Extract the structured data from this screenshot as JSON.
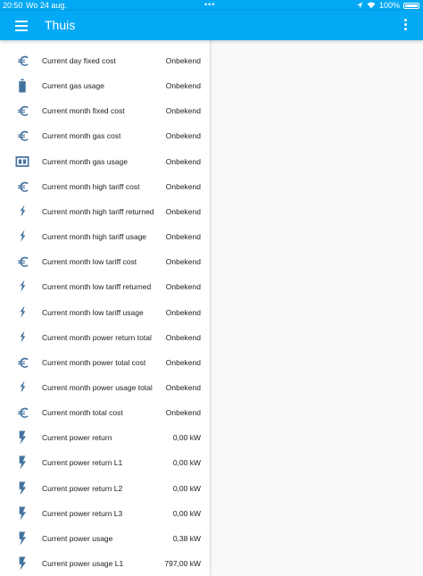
{
  "status_bar": {
    "time": "20:50",
    "date": "Wo 24 aug.",
    "battery": "100%"
  },
  "header": {
    "title": "Thuis"
  },
  "colors": {
    "primary": "#03a9f4",
    "icon": "#44739e",
    "text": "#212121"
  },
  "entities": [
    {
      "icon": "currency-eur-icon",
      "name": "Current day fixed cost",
      "value": "Onbekend"
    },
    {
      "icon": "gas-cylinder-icon",
      "name": "Current gas usage",
      "value": "Onbekend"
    },
    {
      "icon": "currency-eur-icon",
      "name": "Current month fixed cost",
      "value": "Onbekend"
    },
    {
      "icon": "currency-eur-icon",
      "name": "Current month gas cost",
      "value": "Onbekend"
    },
    {
      "icon": "meter-gas-icon",
      "name": "Current month gas usage",
      "value": "Onbekend"
    },
    {
      "icon": "currency-eur-icon",
      "name": "Current month high tariff cost",
      "value": "Onbekend"
    },
    {
      "icon": "flash-icon",
      "name": "Current month high tariff returned",
      "value": "Onbekend"
    },
    {
      "icon": "flash-icon",
      "name": "Current month high tariff usage",
      "value": "Onbekend"
    },
    {
      "icon": "currency-eur-icon",
      "name": "Current month low tariff cost",
      "value": "Onbekend"
    },
    {
      "icon": "flash-icon",
      "name": "Current month low tariff returned",
      "value": "Onbekend"
    },
    {
      "icon": "flash-icon",
      "name": "Current month low tariff usage",
      "value": "Onbekend"
    },
    {
      "icon": "flash-icon",
      "name": "Current month power return total",
      "value": "Onbekend"
    },
    {
      "icon": "currency-eur-icon",
      "name": "Current month power total cost",
      "value": "Onbekend"
    },
    {
      "icon": "flash-icon",
      "name": "Current month power usage total",
      "value": "Onbekend"
    },
    {
      "icon": "currency-eur-icon",
      "name": "Current month total cost",
      "value": "Onbekend"
    },
    {
      "icon": "flash-bolt-icon",
      "name": "Current power return",
      "value": "0,00 kW"
    },
    {
      "icon": "flash-bolt-icon",
      "name": "Current power return L1",
      "value": "0,00 kW"
    },
    {
      "icon": "flash-bolt-icon",
      "name": "Current power return L2",
      "value": "0,00 kW"
    },
    {
      "icon": "flash-bolt-icon",
      "name": "Current power return L3",
      "value": "0,00 kW"
    },
    {
      "icon": "flash-bolt-icon",
      "name": "Current power usage",
      "value": "0,38 kW"
    },
    {
      "icon": "flash-bolt-icon",
      "name": "Current power usage L1",
      "value": "797,00 kW"
    }
  ]
}
